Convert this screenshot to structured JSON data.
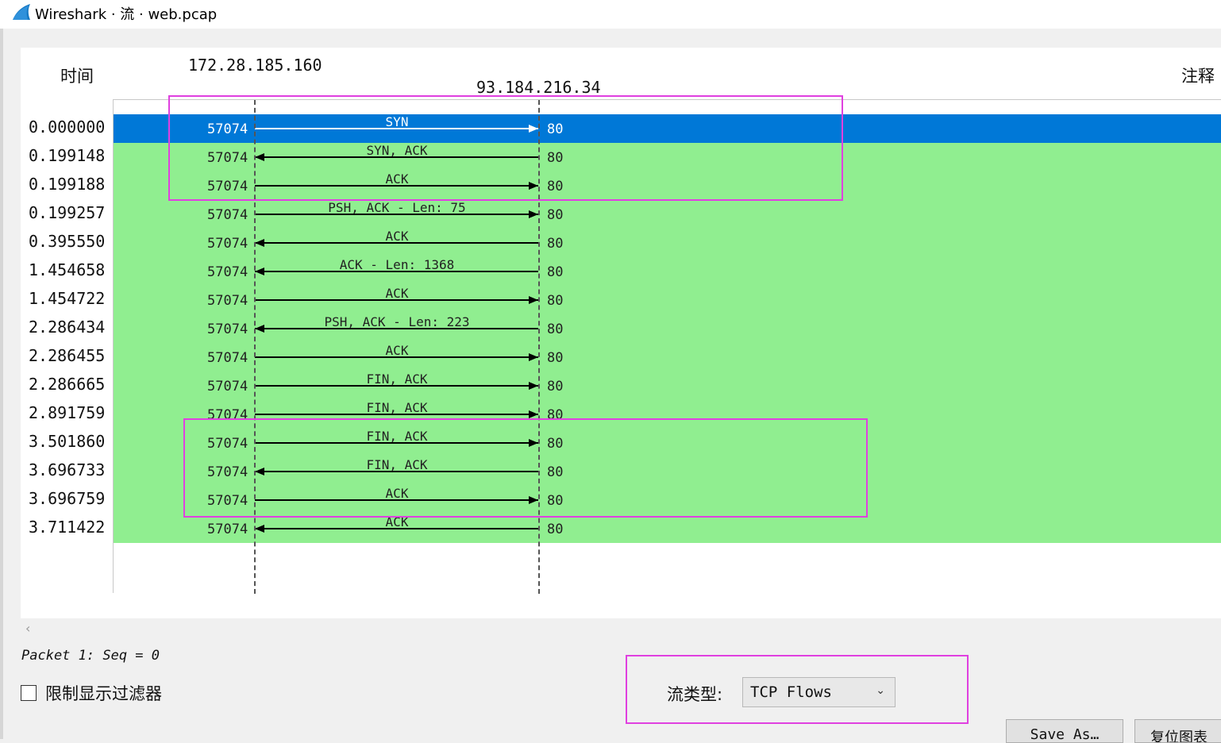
{
  "window": {
    "title": "Wireshark · 流 · web.pcap"
  },
  "header": {
    "time_label": "时间",
    "comment_label": "注释",
    "host_a": "172.28.185.160",
    "host_b": "93.184.216.34"
  },
  "rows": [
    {
      "time": "0.000000",
      "port_a": "57074",
      "label": "SYN",
      "port_b": "80",
      "direction": "right",
      "selected": true
    },
    {
      "time": "0.199148",
      "port_a": "57074",
      "label": "SYN, ACK",
      "port_b": "80",
      "direction": "left"
    },
    {
      "time": "0.199188",
      "port_a": "57074",
      "label": "ACK",
      "port_b": "80",
      "direction": "right"
    },
    {
      "time": "0.199257",
      "port_a": "57074",
      "label": "PSH, ACK - Len: 75",
      "port_b": "80",
      "direction": "right"
    },
    {
      "time": "0.395550",
      "port_a": "57074",
      "label": "ACK",
      "port_b": "80",
      "direction": "left"
    },
    {
      "time": "1.454658",
      "port_a": "57074",
      "label": "ACK - Len: 1368",
      "port_b": "80",
      "direction": "left"
    },
    {
      "time": "1.454722",
      "port_a": "57074",
      "label": "ACK",
      "port_b": "80",
      "direction": "right"
    },
    {
      "time": "2.286434",
      "port_a": "57074",
      "label": "PSH, ACK - Len: 223",
      "port_b": "80",
      "direction": "left"
    },
    {
      "time": "2.286455",
      "port_a": "57074",
      "label": "ACK",
      "port_b": "80",
      "direction": "right"
    },
    {
      "time": "2.286665",
      "port_a": "57074",
      "label": "FIN, ACK",
      "port_b": "80",
      "direction": "right"
    },
    {
      "time": "2.891759",
      "port_a": "57074",
      "label": "FIN, ACK",
      "port_b": "80",
      "direction": "right"
    },
    {
      "time": "3.501860",
      "port_a": "57074",
      "label": "FIN, ACK",
      "port_b": "80",
      "direction": "right"
    },
    {
      "time": "3.696733",
      "port_a": "57074",
      "label": "FIN, ACK",
      "port_b": "80",
      "direction": "left"
    },
    {
      "time": "3.696759",
      "port_a": "57074",
      "label": "ACK",
      "port_b": "80",
      "direction": "right"
    },
    {
      "time": "3.711422",
      "port_a": "57074",
      "label": "ACK",
      "port_b": "80",
      "direction": "left"
    }
  ],
  "status": {
    "text": "Packet 1: Seq = 0"
  },
  "controls": {
    "limit_filter_label": "限制显示过滤器",
    "limit_filter_checked": false,
    "flow_type_label": "流类型:",
    "flow_type_value": "TCP Flows",
    "save_as_label": "Save As…",
    "reset_label": "复位图表"
  },
  "colors": {
    "row_band": "#90ee90",
    "selected_band": "#0078d7",
    "highlight_box": "#e040e0"
  }
}
